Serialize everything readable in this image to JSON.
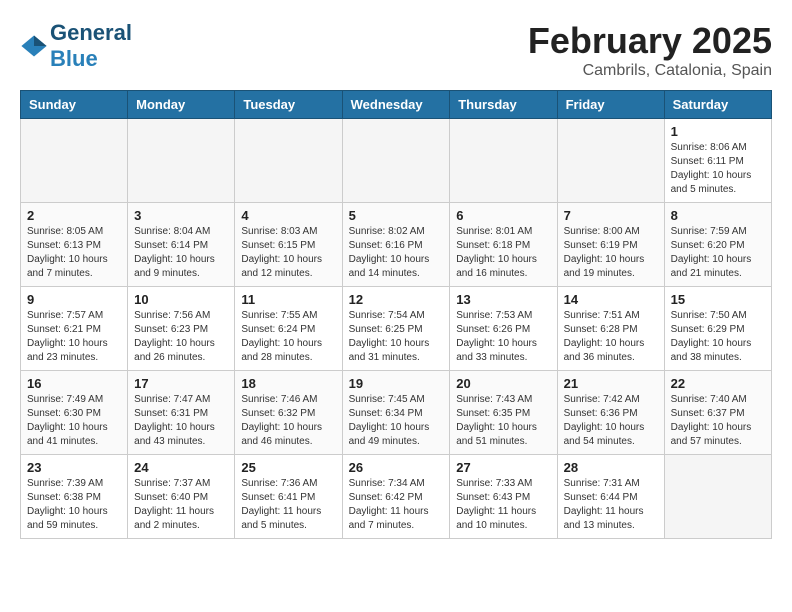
{
  "header": {
    "logo_general": "General",
    "logo_blue": "Blue",
    "month_title": "February 2025",
    "location": "Cambrils, Catalonia, Spain"
  },
  "weekdays": [
    "Sunday",
    "Monday",
    "Tuesday",
    "Wednesday",
    "Thursday",
    "Friday",
    "Saturday"
  ],
  "weeks": [
    [
      {
        "day": "",
        "info": ""
      },
      {
        "day": "",
        "info": ""
      },
      {
        "day": "",
        "info": ""
      },
      {
        "day": "",
        "info": ""
      },
      {
        "day": "",
        "info": ""
      },
      {
        "day": "",
        "info": ""
      },
      {
        "day": "1",
        "info": "Sunrise: 8:06 AM\nSunset: 6:11 PM\nDaylight: 10 hours and 5 minutes."
      }
    ],
    [
      {
        "day": "2",
        "info": "Sunrise: 8:05 AM\nSunset: 6:13 PM\nDaylight: 10 hours and 7 minutes."
      },
      {
        "day": "3",
        "info": "Sunrise: 8:04 AM\nSunset: 6:14 PM\nDaylight: 10 hours and 9 minutes."
      },
      {
        "day": "4",
        "info": "Sunrise: 8:03 AM\nSunset: 6:15 PM\nDaylight: 10 hours and 12 minutes."
      },
      {
        "day": "5",
        "info": "Sunrise: 8:02 AM\nSunset: 6:16 PM\nDaylight: 10 hours and 14 minutes."
      },
      {
        "day": "6",
        "info": "Sunrise: 8:01 AM\nSunset: 6:18 PM\nDaylight: 10 hours and 16 minutes."
      },
      {
        "day": "7",
        "info": "Sunrise: 8:00 AM\nSunset: 6:19 PM\nDaylight: 10 hours and 19 minutes."
      },
      {
        "day": "8",
        "info": "Sunrise: 7:59 AM\nSunset: 6:20 PM\nDaylight: 10 hours and 21 minutes."
      }
    ],
    [
      {
        "day": "9",
        "info": "Sunrise: 7:57 AM\nSunset: 6:21 PM\nDaylight: 10 hours and 23 minutes."
      },
      {
        "day": "10",
        "info": "Sunrise: 7:56 AM\nSunset: 6:23 PM\nDaylight: 10 hours and 26 minutes."
      },
      {
        "day": "11",
        "info": "Sunrise: 7:55 AM\nSunset: 6:24 PM\nDaylight: 10 hours and 28 minutes."
      },
      {
        "day": "12",
        "info": "Sunrise: 7:54 AM\nSunset: 6:25 PM\nDaylight: 10 hours and 31 minutes."
      },
      {
        "day": "13",
        "info": "Sunrise: 7:53 AM\nSunset: 6:26 PM\nDaylight: 10 hours and 33 minutes."
      },
      {
        "day": "14",
        "info": "Sunrise: 7:51 AM\nSunset: 6:28 PM\nDaylight: 10 hours and 36 minutes."
      },
      {
        "day": "15",
        "info": "Sunrise: 7:50 AM\nSunset: 6:29 PM\nDaylight: 10 hours and 38 minutes."
      }
    ],
    [
      {
        "day": "16",
        "info": "Sunrise: 7:49 AM\nSunset: 6:30 PM\nDaylight: 10 hours and 41 minutes."
      },
      {
        "day": "17",
        "info": "Sunrise: 7:47 AM\nSunset: 6:31 PM\nDaylight: 10 hours and 43 minutes."
      },
      {
        "day": "18",
        "info": "Sunrise: 7:46 AM\nSunset: 6:32 PM\nDaylight: 10 hours and 46 minutes."
      },
      {
        "day": "19",
        "info": "Sunrise: 7:45 AM\nSunset: 6:34 PM\nDaylight: 10 hours and 49 minutes."
      },
      {
        "day": "20",
        "info": "Sunrise: 7:43 AM\nSunset: 6:35 PM\nDaylight: 10 hours and 51 minutes."
      },
      {
        "day": "21",
        "info": "Sunrise: 7:42 AM\nSunset: 6:36 PM\nDaylight: 10 hours and 54 minutes."
      },
      {
        "day": "22",
        "info": "Sunrise: 7:40 AM\nSunset: 6:37 PM\nDaylight: 10 hours and 57 minutes."
      }
    ],
    [
      {
        "day": "23",
        "info": "Sunrise: 7:39 AM\nSunset: 6:38 PM\nDaylight: 10 hours and 59 minutes."
      },
      {
        "day": "24",
        "info": "Sunrise: 7:37 AM\nSunset: 6:40 PM\nDaylight: 11 hours and 2 minutes."
      },
      {
        "day": "25",
        "info": "Sunrise: 7:36 AM\nSunset: 6:41 PM\nDaylight: 11 hours and 5 minutes."
      },
      {
        "day": "26",
        "info": "Sunrise: 7:34 AM\nSunset: 6:42 PM\nDaylight: 11 hours and 7 minutes."
      },
      {
        "day": "27",
        "info": "Sunrise: 7:33 AM\nSunset: 6:43 PM\nDaylight: 11 hours and 10 minutes."
      },
      {
        "day": "28",
        "info": "Sunrise: 7:31 AM\nSunset: 6:44 PM\nDaylight: 11 hours and 13 minutes."
      },
      {
        "day": "",
        "info": ""
      }
    ]
  ]
}
